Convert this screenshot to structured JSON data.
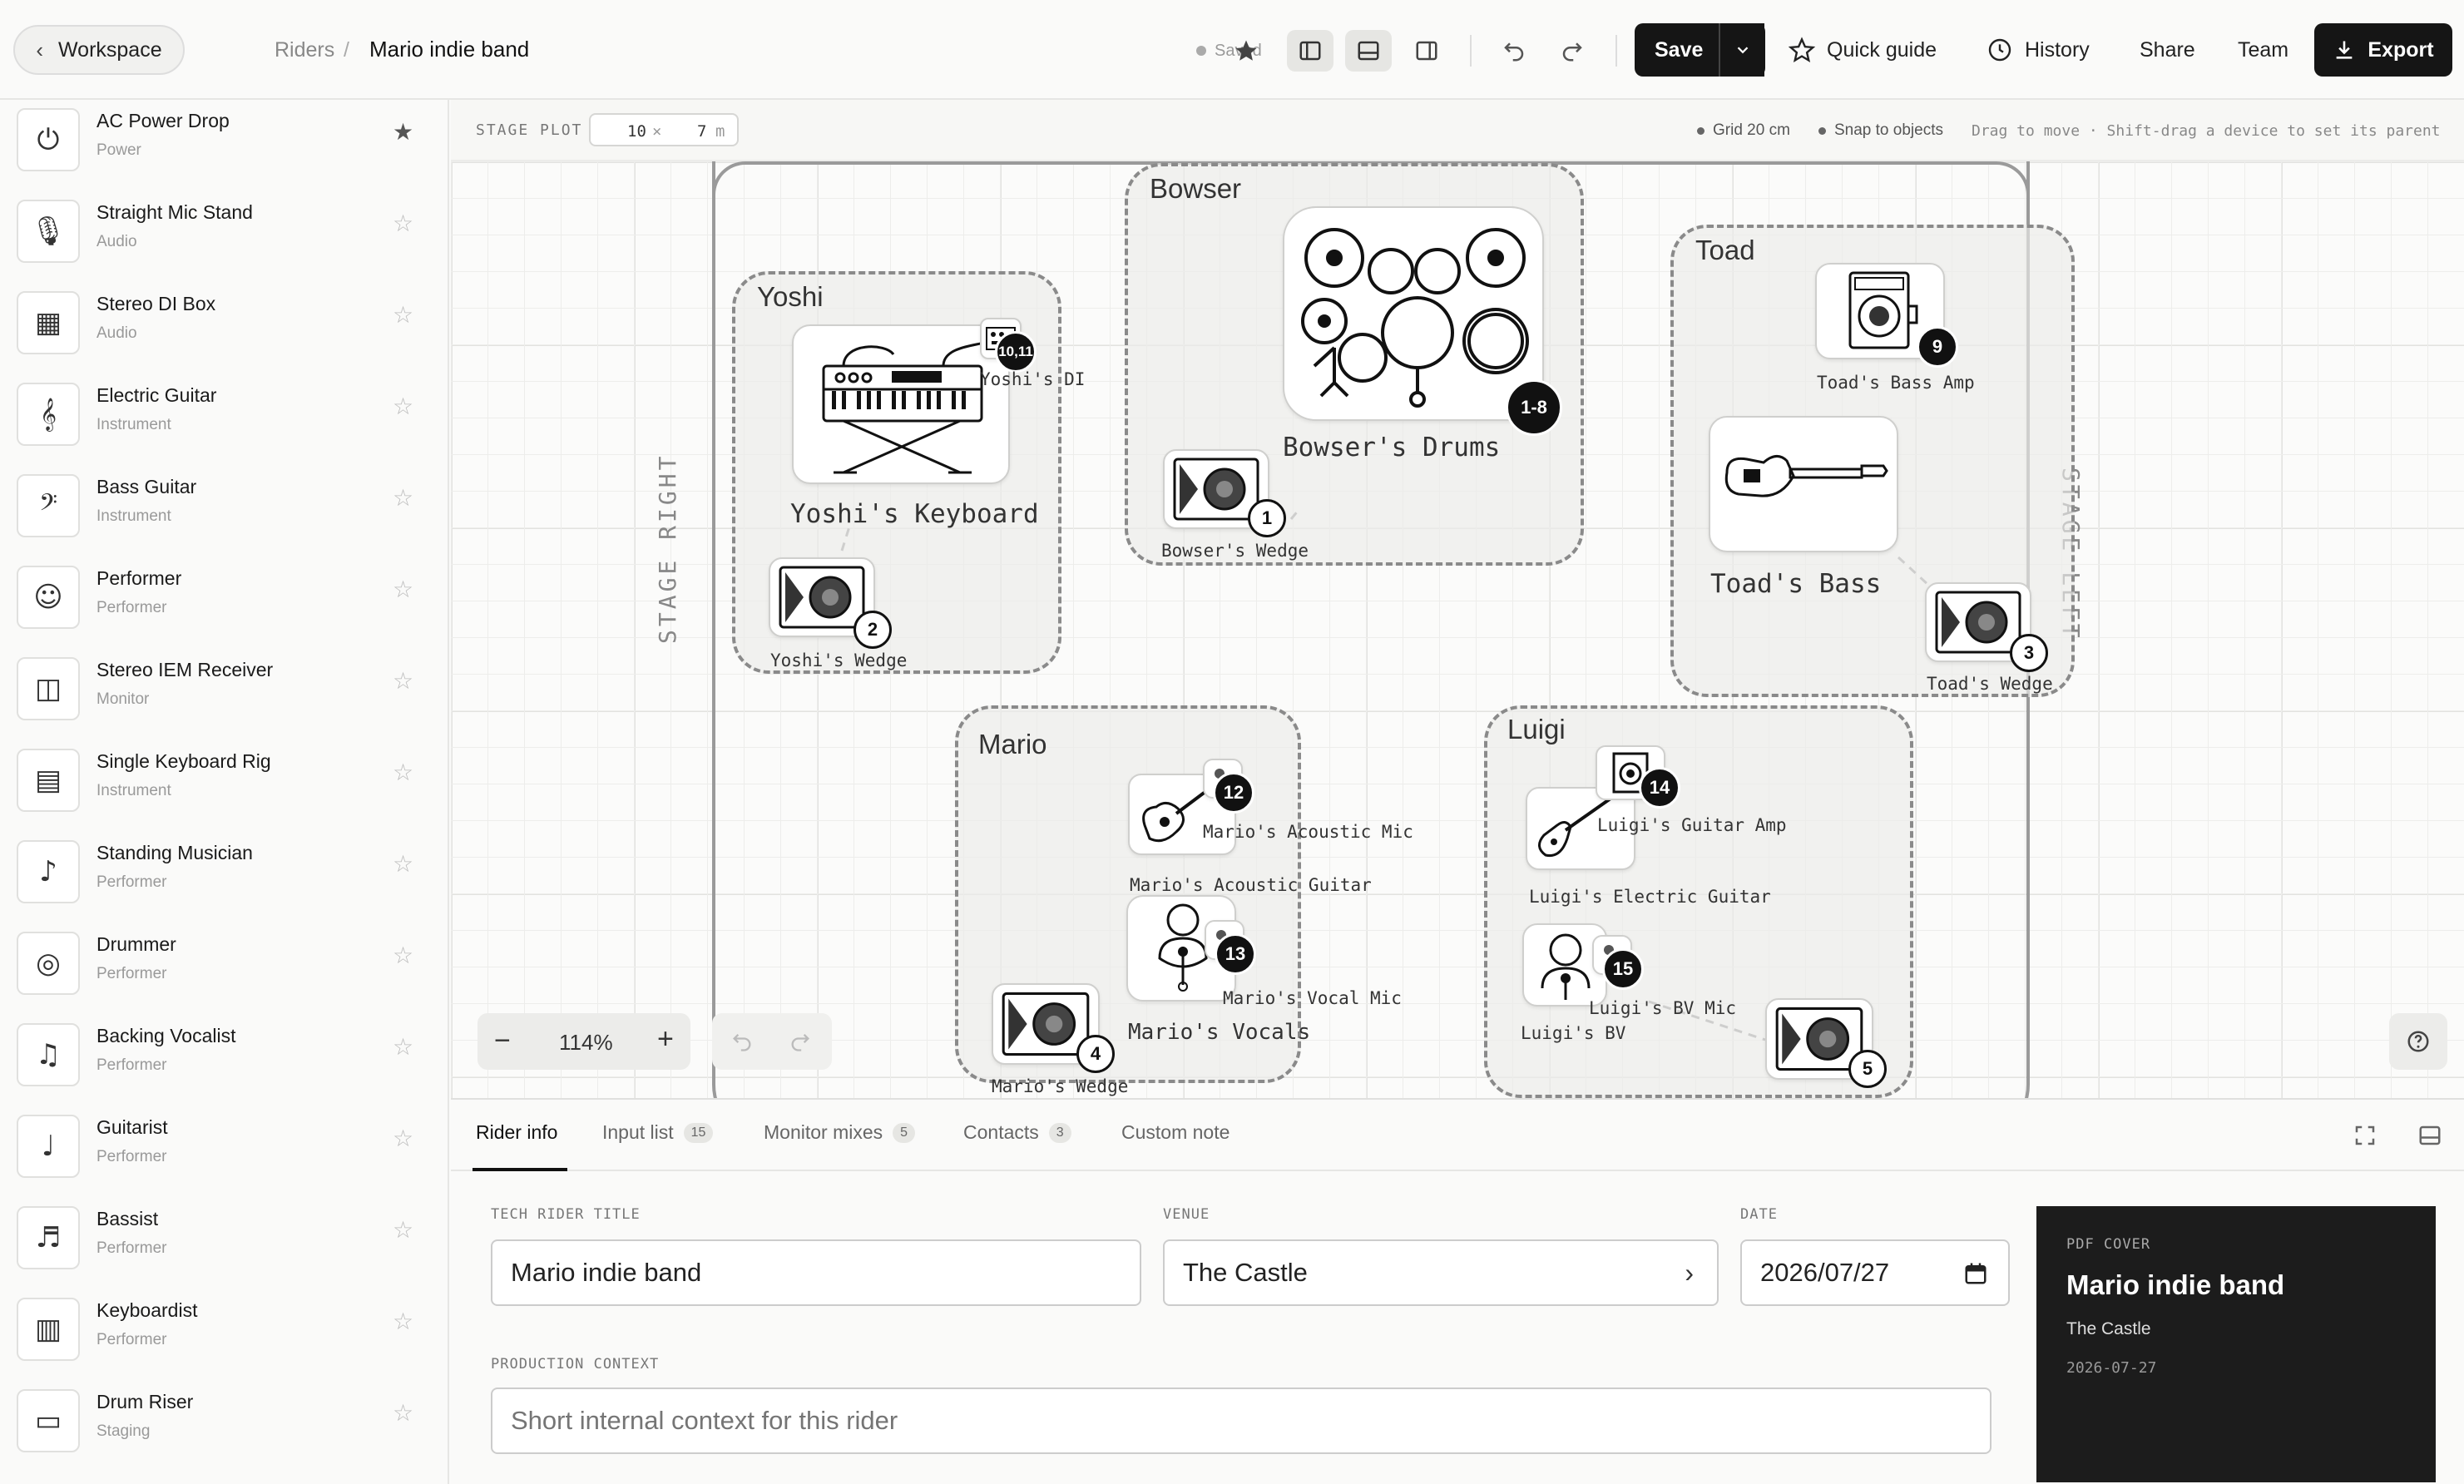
{
  "header": {
    "workspace_label": "Workspace",
    "breadcrumb_root": "Riders",
    "breadcrumb_sep": "/",
    "title": "Mario indie band",
    "saved_status": "Saved",
    "save_label": "Save",
    "quick_guide_label": "Quick guide",
    "history_label": "History",
    "share_label": "Share",
    "team_label": "Team",
    "export_label": "Export"
  },
  "library": {
    "items": [
      {
        "name": "AC Power Drop",
        "category": "Power",
        "icon": "power-drop-icon",
        "starred": true
      },
      {
        "name": "Straight Mic Stand",
        "category": "Audio",
        "icon": "mic-stand-icon",
        "starred": false
      },
      {
        "name": "Stereo DI Box",
        "category": "Audio",
        "icon": "di-box-icon",
        "starred": false
      },
      {
        "name": "Electric Guitar",
        "category": "Instrument",
        "icon": "electric-guitar-icon",
        "starred": false
      },
      {
        "name": "Bass Guitar",
        "category": "Instrument",
        "icon": "bass-guitar-icon",
        "starred": false
      },
      {
        "name": "Performer",
        "category": "Performer",
        "icon": "performer-icon",
        "starred": false
      },
      {
        "name": "Stereo IEM Receiver",
        "category": "Monitor",
        "icon": "iem-receiver-icon",
        "starred": false
      },
      {
        "name": "Single Keyboard Rig",
        "category": "Instrument",
        "icon": "keyboard-rig-icon",
        "starred": false
      },
      {
        "name": "Standing Musician",
        "category": "Performer",
        "icon": "standing-musician-icon",
        "starred": false
      },
      {
        "name": "Drummer",
        "category": "Performer",
        "icon": "drummer-icon",
        "starred": false
      },
      {
        "name": "Backing Vocalist",
        "category": "Performer",
        "icon": "backing-vocalist-icon",
        "starred": false
      },
      {
        "name": "Guitarist",
        "category": "Performer",
        "icon": "guitarist-icon",
        "starred": false
      },
      {
        "name": "Bassist",
        "category": "Performer",
        "icon": "bassist-icon",
        "starred": false
      },
      {
        "name": "Keyboardist",
        "category": "Performer",
        "icon": "keyboardist-icon",
        "starred": false
      },
      {
        "name": "Drum Riser",
        "category": "Staging",
        "icon": "drum-riser-icon",
        "starred": false
      }
    ]
  },
  "stage_bar": {
    "label": "STAGE PLOT",
    "width_value": "10",
    "times": "×",
    "depth_value": "7",
    "unit": "m",
    "grid_label": "Grid 20 cm",
    "snap_label": "Snap to objects",
    "hint": "Drag to move · Shift-drag a device to set its parent"
  },
  "stage": {
    "right_label": "STAGE RIGHT",
    "left_label": "STAGE LEFT",
    "zoom": "114%",
    "groups": {
      "yoshi": "Yoshi",
      "bowser": "Bowser",
      "toad": "Toad",
      "mario": "Mario",
      "luigi": "Luigi"
    },
    "devices": {
      "yoshi_keyboard": "Yoshi's Keyboard",
      "yoshi_di": "Yoshi's DI",
      "yoshi_di_badge": "10,11",
      "yoshi_wedge": "Yoshi's Wedge",
      "yoshi_wedge_badge": "2",
      "bowser_drums": "Bowser's Drums",
      "bowser_drums_badge": "1-8",
      "bowser_wedge": "Bowser's Wedge",
      "bowser_wedge_badge": "1",
      "toad_bass_amp": "Toad's Bass Amp",
      "toad_bass_amp_badge": "9",
      "toad_bass": "Toad's Bass",
      "toad_wedge": "Toad's Wedge",
      "toad_wedge_badge": "3",
      "mario_acoustic_mic": "Mario's Acoustic Mic",
      "mario_acoustic_mic_badge": "12",
      "mario_acoustic_guitar": "Mario's Acoustic Guitar",
      "mario_vocal_mic": "Mario's Vocal Mic",
      "mario_vocal_mic_badge": "13",
      "mario_vocals": "Mario's Vocals",
      "mario_wedge": "Mario's Wedge",
      "mario_wedge_badge": "4",
      "luigi_guitar_amp": "Luigi's Guitar Amp",
      "luigi_guitar_amp_badge": "14",
      "luigi_electric_guitar": "Luigi's Electric Guitar",
      "luigi_bv_mic": "Luigi's BV Mic",
      "luigi_bv_mic_badge": "15",
      "luigi_bv": "Luigi's BV",
      "luigi_wedge_badge": "5"
    }
  },
  "tabs": [
    {
      "label": "Rider info",
      "count": ""
    },
    {
      "label": "Input list",
      "count": "15"
    },
    {
      "label": "Monitor mixes",
      "count": "5"
    },
    {
      "label": "Contacts",
      "count": "3"
    },
    {
      "label": "Custom note",
      "count": ""
    }
  ],
  "rider_info": {
    "title_label": "TECH RIDER TITLE",
    "title_value": "Mario indie band",
    "venue_label": "VENUE",
    "venue_value": "The Castle",
    "date_label": "DATE",
    "date_value": "2026/07/27",
    "context_label": "PRODUCTION CONTEXT",
    "context_placeholder": "Short internal context for this rider"
  },
  "pdf_cover": {
    "label": "PDF COVER",
    "title": "Mario indie band",
    "venue": "The Castle",
    "date": "2026-07-27"
  },
  "colors": {
    "accent": "#151515",
    "background": "#fafaf9",
    "group_border": "#8a8a8a"
  }
}
